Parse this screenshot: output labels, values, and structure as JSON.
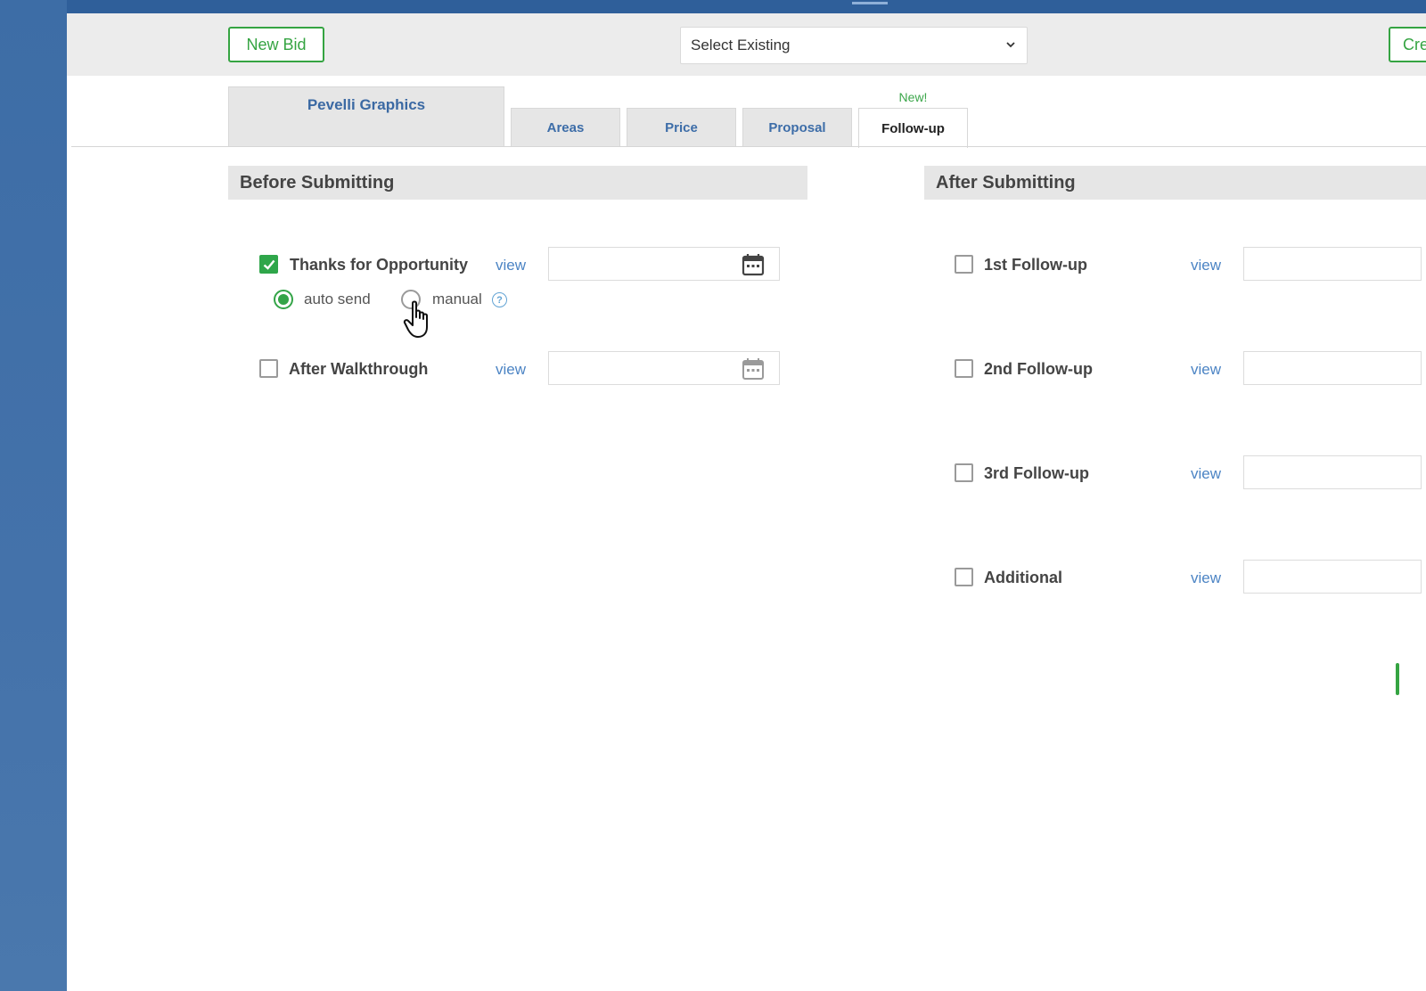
{
  "toolbar": {
    "new_bid_label": "New Bid",
    "select_existing_value": "Select Existing",
    "create_label_partial": "Cre"
  },
  "tabs": {
    "company": "Pevelli Graphics",
    "areas": "Areas",
    "price": "Price",
    "proposal": "Proposal",
    "followup": "Follow-up",
    "followup_badge": "New!",
    "active": "Follow-up"
  },
  "before": {
    "title": "Before Submitting",
    "items": [
      {
        "label": "Thanks for Opportunity",
        "view": "view",
        "checked": true
      },
      {
        "label": "After Walkthrough",
        "view": "view",
        "checked": false
      }
    ],
    "send_mode": {
      "auto_label": "auto send",
      "manual_label": "manual",
      "selected": "auto send",
      "help_icon": "question-circle-icon"
    }
  },
  "after": {
    "title": "After Submitting",
    "items": [
      {
        "label": "1st Follow-up",
        "view": "view",
        "checked": false
      },
      {
        "label": "2nd Follow-up",
        "view": "view",
        "checked": false
      },
      {
        "label": "3rd Follow-up",
        "view": "view",
        "checked": false
      },
      {
        "label": "Additional",
        "view": "view",
        "checked": false
      }
    ]
  },
  "colors": {
    "accent_green": "#35a442",
    "link_blue": "#4c84c4",
    "tab_blue": "#3d6da8",
    "frame_blue": "#3e6ea6"
  }
}
